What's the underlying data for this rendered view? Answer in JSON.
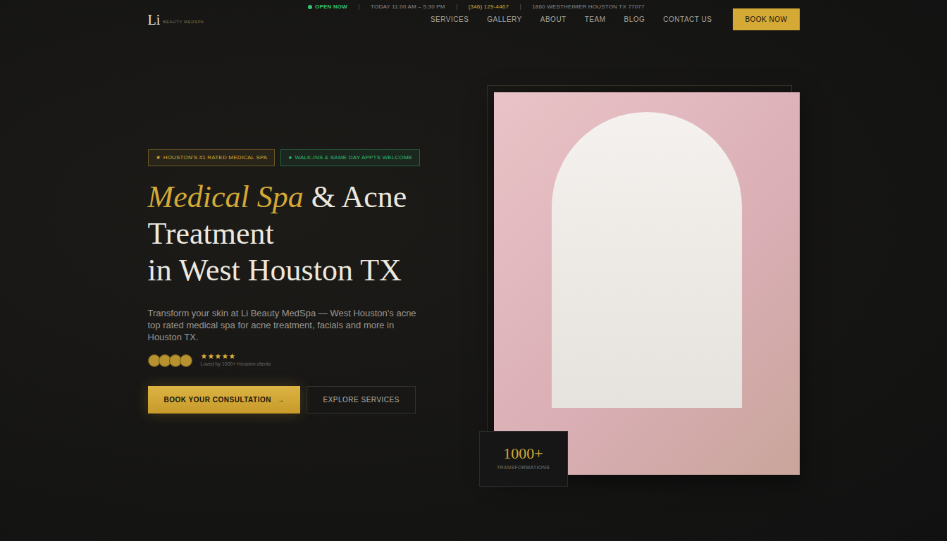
{
  "top_bar": {
    "status": "OPEN NOW",
    "hours": "TODAY 11:00 AM – 5:30 PM",
    "phone": "(346) 129-4467",
    "address": "1860 WESTHEIMER HOUSTON TX 77077"
  },
  "logo": {
    "mark": "Li",
    "name": "BEAUTY MEDSPA"
  },
  "nav": {
    "items": [
      {
        "label": "SERVICES"
      },
      {
        "label": "GALLERY"
      },
      {
        "label": "ABOUT"
      },
      {
        "label": "TEAM"
      },
      {
        "label": "BLOG"
      },
      {
        "label": "CONTACT US"
      }
    ],
    "cta": "BOOK NOW"
  },
  "hero": {
    "badges": [
      {
        "icon": "★",
        "text": "HOUSTON'S #1 RATED MEDICAL SPA",
        "color": "#d4a935"
      },
      {
        "icon": "●",
        "text": "WALK-INS & SAME DAY APPTS WELCOME",
        "color": "#2fbf71"
      }
    ],
    "heading": {
      "accent": "Medical Spa",
      "rest": " & Acne",
      "line2": "Treatment",
      "line3": "in West Houston TX"
    },
    "paragraph": "Transform your skin at Li Beauty MedSpa — West Houston's acne top rated medical spa for acne treatment, facials and more in Houston TX.",
    "rating": {
      "stars": 5,
      "caption": "Loved by 1000+ Houston clients"
    },
    "buttons": {
      "primary": "BOOK YOUR CONSULTATION",
      "primary_arrow": "→",
      "secondary": "EXPLORE SERVICES"
    },
    "stat": {
      "value": "1000+",
      "label": "TRANSFORMATIONS"
    }
  }
}
